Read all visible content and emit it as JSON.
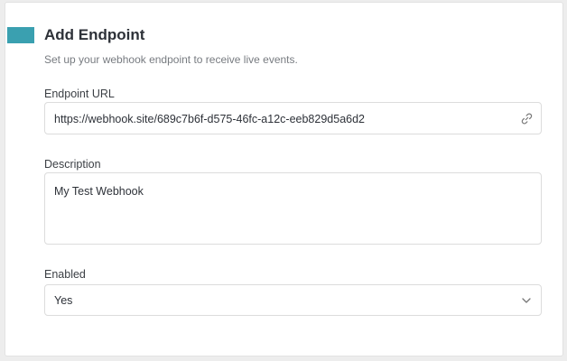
{
  "header": {
    "title": "Add Endpoint",
    "subtitle": "Set up your webhook endpoint to receive live events."
  },
  "form": {
    "endpoint_url": {
      "label": "Endpoint URL",
      "value": "https://webhook.site/689c7b6f-d575-46fc-a12c-eeb829d5a6d2",
      "icon": "link-icon"
    },
    "description": {
      "label": "Description",
      "value": "My Test Webhook"
    },
    "enabled": {
      "label": "Enabled",
      "value": "Yes",
      "icon": "chevron-down-icon"
    }
  },
  "colors": {
    "accent": "#3aa0b0",
    "background": "#ededed",
    "card": "#ffffff",
    "border": "#dcdcdc"
  }
}
